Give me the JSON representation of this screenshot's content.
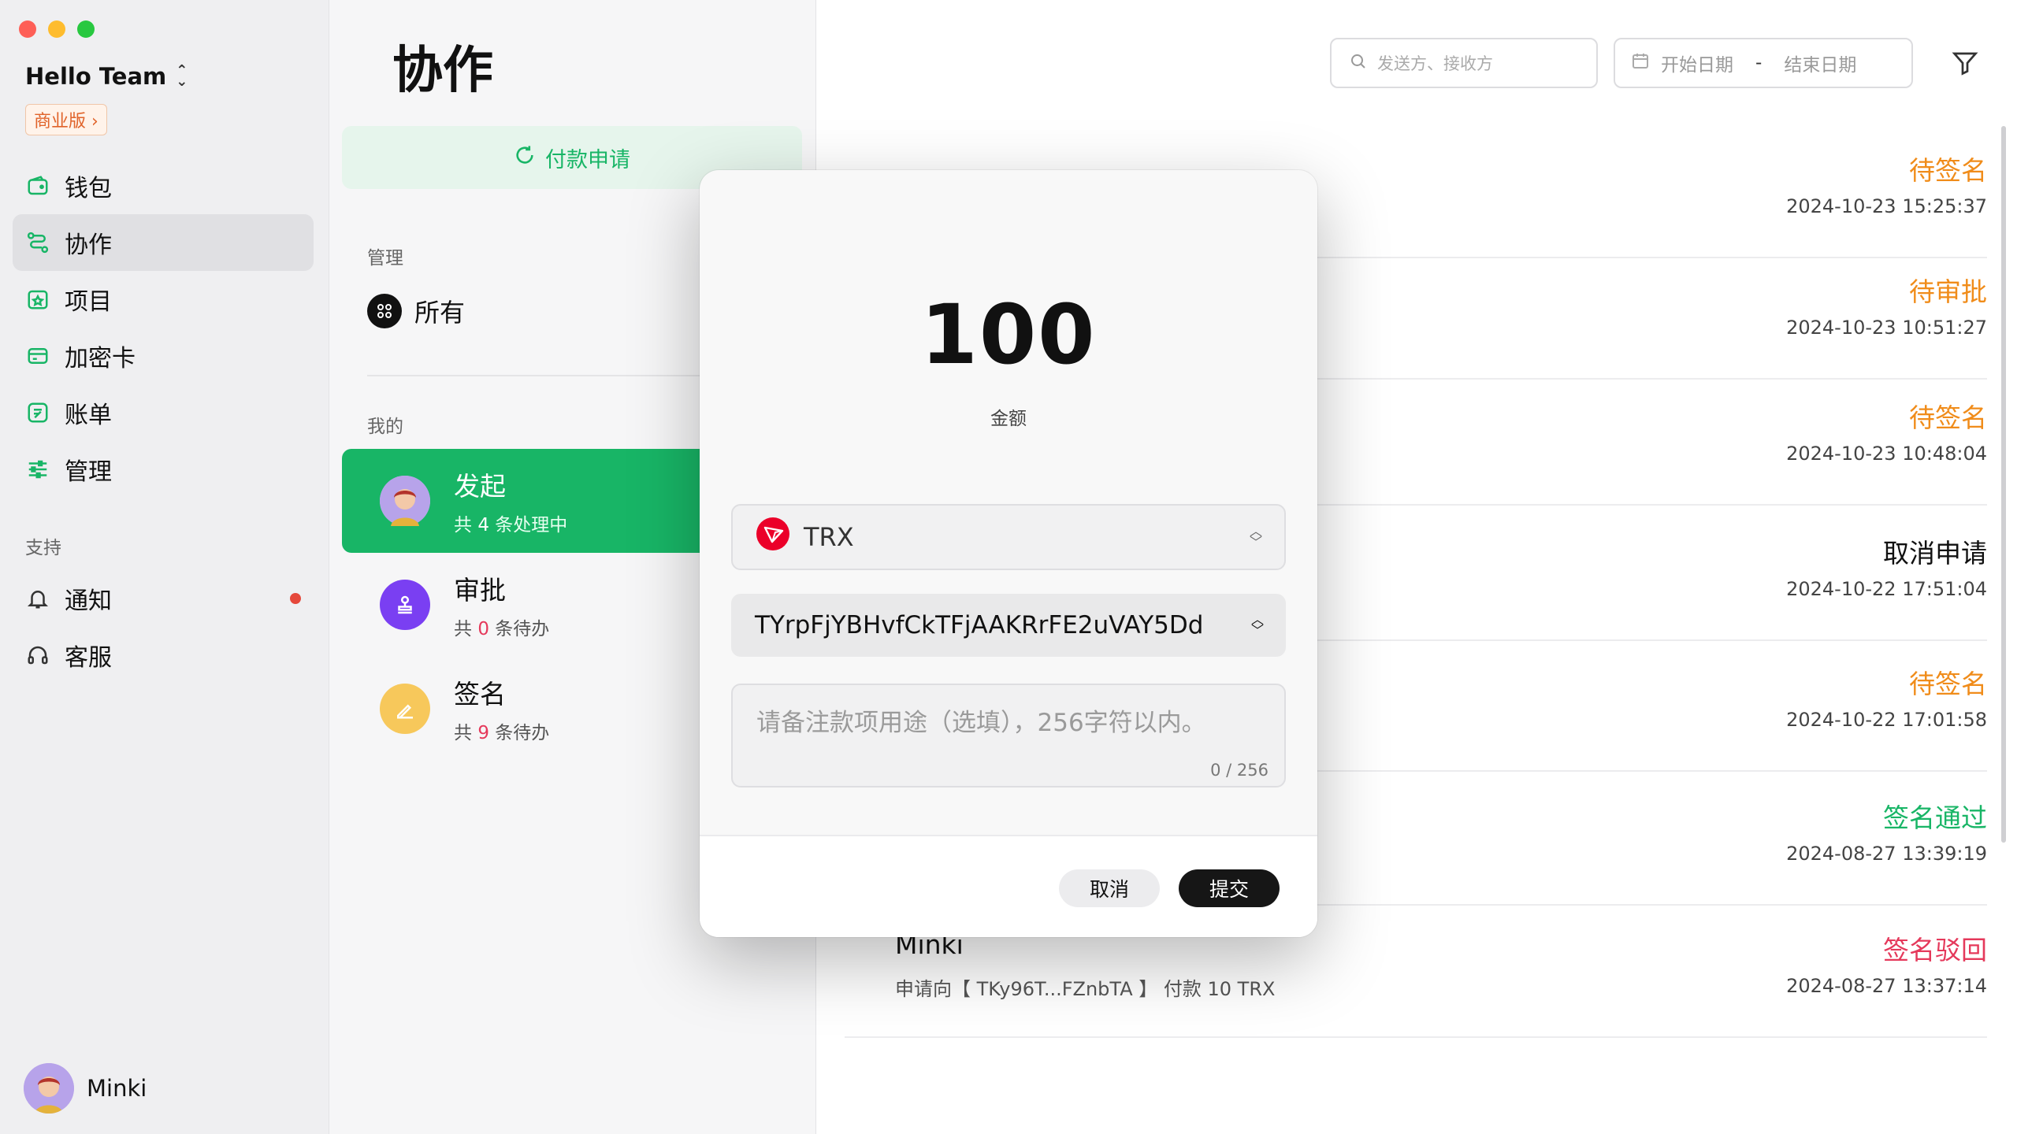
{
  "sidebar": {
    "team_name": "Hello Team",
    "plan_badge": "商业版 ›",
    "nav": [
      {
        "label": "钱包",
        "icon": "wallet-icon"
      },
      {
        "label": "协作",
        "icon": "collaborate-icon",
        "active": true
      },
      {
        "label": "项目",
        "icon": "project-icon"
      },
      {
        "label": "加密卡",
        "icon": "card-icon"
      },
      {
        "label": "账单",
        "icon": "bill-icon"
      },
      {
        "label": "管理",
        "icon": "settings-sliders-icon"
      }
    ],
    "support_label": "支持",
    "support": [
      {
        "label": "通知",
        "icon": "bell-icon",
        "has_dot": true
      },
      {
        "label": "客服",
        "icon": "headset-icon"
      }
    ],
    "user_name": "Minki"
  },
  "middle": {
    "title": "协作",
    "pay_request_label": "付款申请",
    "manage_label": "管理",
    "all_label": "所有",
    "mine_label": "我的",
    "categories": [
      {
        "title": "发起",
        "sub_prefix": "共",
        "count": "4",
        "sub_suffix": "条处理中",
        "active": true
      },
      {
        "title": "审批",
        "sub_prefix": "共",
        "count": "0",
        "sub_suffix": "条待办"
      },
      {
        "title": "签名",
        "sub_prefix": "共",
        "count": "9",
        "sub_suffix": "条待办"
      }
    ]
  },
  "right": {
    "search_placeholder": "发送方、接收方",
    "date_start": "开始日期",
    "date_sep": "-",
    "date_end": "结束日期",
    "rows": [
      {
        "name": "",
        "desc": "",
        "status": "待签名",
        "status_color": "orange",
        "time": "2024-10-23 15:25:37"
      },
      {
        "name": "",
        "desc": "",
        "status": "待审批",
        "status_color": "orange",
        "time": "2024-10-23 10:51:27"
      },
      {
        "name": "",
        "desc": "",
        "status": "待签名",
        "status_color": "orange",
        "time": "2024-10-23 10:48:04"
      },
      {
        "name": "",
        "desc": "",
        "status": "取消申请",
        "status_color": "black",
        "time": "2024-10-22 17:51:04"
      },
      {
        "name": "",
        "desc": "",
        "status": "待签名",
        "status_color": "orange",
        "time": "2024-10-22 17:01:58"
      },
      {
        "name": "",
        "desc": "",
        "status": "签名通过",
        "status_color": "green",
        "time": "2024-08-27 13:39:19"
      },
      {
        "name": "Minki",
        "desc": "申请向【 TKy96T...FZnbTA 】 付款 10 TRX",
        "status": "签名驳回",
        "status_color": "pink",
        "time": "2024-08-27 13:37:14"
      }
    ]
  },
  "modal": {
    "amount": "100",
    "amount_label": "金额",
    "token": "TRX",
    "address": "TYrpFjYBHvfCkTFjAAKRrFE2uVAY5Dd",
    "memo_placeholder": "请备注款项用途（选填），256字符以内。",
    "memo_count": "0 / 256",
    "cancel_label": "取消",
    "submit_label": "提交"
  }
}
